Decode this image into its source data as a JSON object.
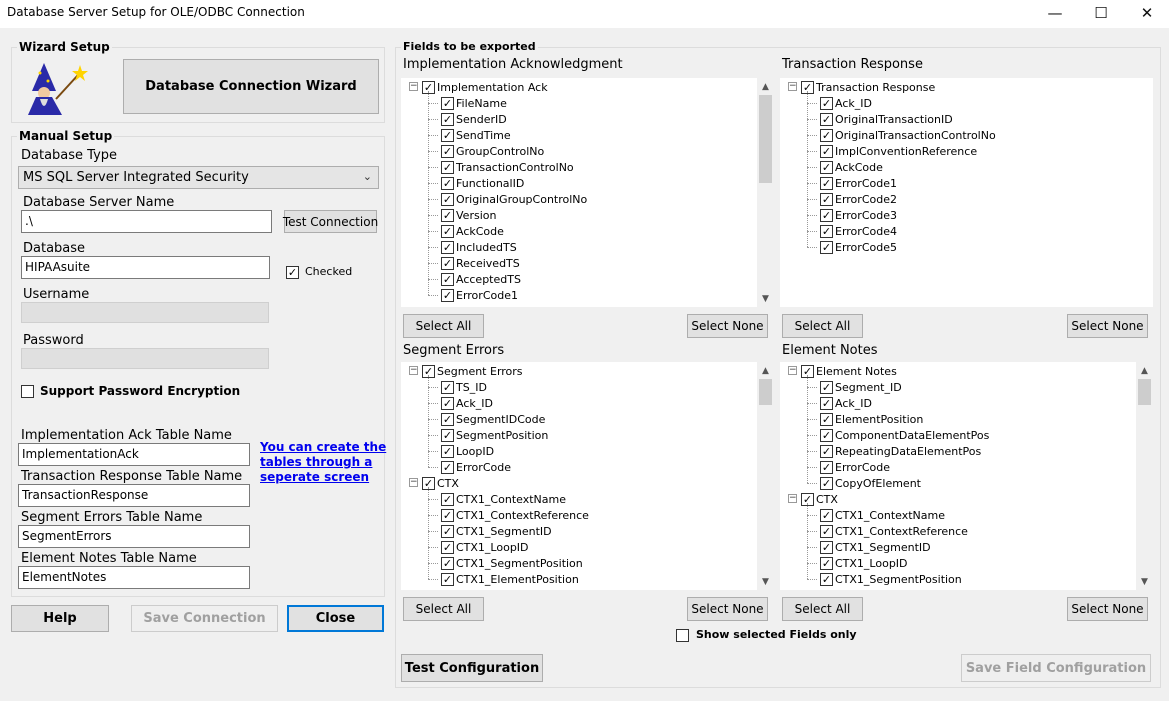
{
  "window": {
    "title": "Database Server Setup for OLE/ODBC Connection",
    "minimize": "—",
    "maximize": "☐",
    "close": "✕"
  },
  "wizard": {
    "group_label": "Wizard Setup",
    "button_label": "Database Connection Wizard"
  },
  "manual": {
    "group_label": "Manual Setup",
    "db_type_label": "Database Type",
    "db_type_value": "MS SQL Server Integrated Security",
    "server_name_label": "Database Server Name",
    "server_name_value": ".\\",
    "test_connection": "Test Connection",
    "database_label": "Database",
    "database_value": "HIPAAsuite",
    "checked_label": "Checked",
    "username_label": "Username",
    "password_label": "Password",
    "support_encryption": "Support Password Encryption",
    "impl_table_label": "Implementation Ack Table Name",
    "impl_table_value": "ImplementationAck",
    "tr_table_label": "Transaction Response Table Name",
    "tr_table_value": "TransactionResponse",
    "se_table_label": "Segment Errors Table Name",
    "se_table_value": "SegmentErrors",
    "en_table_label": "Element Notes Table Name",
    "en_table_value": "ElementNotes",
    "create_link": [
      "You can create the",
      "tables through a",
      "seperate screen"
    ]
  },
  "bottom_left": {
    "help": "Help",
    "save_connection": "Save Connection",
    "close": "Close"
  },
  "fields": {
    "group_label": "Fields to be exported",
    "select_all": "Select All",
    "select_none": "Select None",
    "show_selected": "Show selected Fields only",
    "test_configuration": "Test Configuration",
    "save_field_configuration": "Save Field Configuration",
    "panels": {
      "impl": {
        "title": "Implementation Acknowledgment",
        "root": "Implementation Ack",
        "items": [
          "FileName",
          "SenderID",
          "SendTime",
          "GroupControlNo",
          "TransactionControlNo",
          "FunctionalID",
          "OriginalGroupControlNo",
          "Version",
          "AckCode",
          "IncludedTS",
          "ReceivedTS",
          "AcceptedTS",
          "ErrorCode1"
        ]
      },
      "tr": {
        "title": "Transaction Response",
        "root": "Transaction Response",
        "items": [
          "Ack_ID",
          "OriginalTransactionID",
          "OriginalTransactionControlNo",
          "ImplConventionReference",
          "AckCode",
          "ErrorCode1",
          "ErrorCode2",
          "ErrorCode3",
          "ErrorCode4",
          "ErrorCode5"
        ]
      },
      "se": {
        "title": "Segment Errors",
        "root": "Segment Errors",
        "items": [
          "TS_ID",
          "Ack_ID",
          "SegmentIDCode",
          "SegmentPosition",
          "LoopID",
          "ErrorCode"
        ],
        "sub_root": "CTX",
        "sub_items": [
          "CTX1_ContextName",
          "CTX1_ContextReference",
          "CTX1_SegmentID",
          "CTX1_LoopID",
          "CTX1_SegmentPosition",
          "CTX1_ElementPosition"
        ]
      },
      "en": {
        "title": "Element Notes",
        "root": "Element Notes",
        "items": [
          "Segment_ID",
          "Ack_ID",
          "ElementPosition",
          "ComponentDataElementPos",
          "RepeatingDataElementPos",
          "ErrorCode",
          "CopyOfElement"
        ],
        "sub_root": "CTX",
        "sub_items": [
          "CTX1_ContextName",
          "CTX1_ContextReference",
          "CTX1_SegmentID",
          "CTX1_LoopID",
          "CTX1_SegmentPosition"
        ]
      }
    }
  }
}
